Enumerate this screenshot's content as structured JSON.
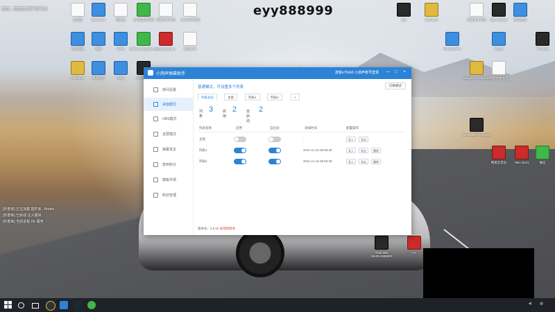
{
  "stream": {
    "title": "eyy888999",
    "top_left_text": "嘿嘿...嘿嘿嘿   网干还不来",
    "log_lines": [
      "[外部库] 正在加载 插件库...Hooks",
      "[外部库] 已启动 注入模块",
      "[外部库] 当前进程 DE 服务"
    ]
  },
  "desktop_icons": [
    {
      "label": "此电脑",
      "style": "doc"
    },
    {
      "label": "Bandicam",
      "style": "blue"
    },
    {
      "label": "回收站",
      "style": "doc"
    },
    {
      "label": "360安全浏览器",
      "style": "green"
    },
    {
      "label": "新建文本文档",
      "style": "doc"
    },
    {
      "label": "2021年终总结",
      "style": "doc"
    },
    {
      "label": "控制面板",
      "style": "blue"
    },
    {
      "label": "网络",
      "style": "blue"
    },
    {
      "label": "WPS",
      "style": "blue"
    },
    {
      "label": "GeForce Experience",
      "style": "green"
    },
    {
      "label": "Redeemtoken",
      "style": "red"
    },
    {
      "label": "新建文本",
      "style": "doc"
    },
    {
      "label": "WeGame",
      "style": "yellow"
    },
    {
      "label": "暴风影音",
      "style": "blue"
    },
    {
      "label": "Uplay",
      "style": "blue"
    },
    {
      "label": "Overwatch",
      "style": "dark"
    },
    {
      "label": "QQ",
      "style": "dark"
    },
    {
      "label": "WeGame",
      "style": "yellow"
    },
    {
      "label": "新建文本文档",
      "style": "doc"
    },
    {
      "label": "Epic Games",
      "style": "dark"
    },
    {
      "label": "腾讯会议",
      "style": "blue"
    },
    {
      "label": "DiamondPro",
      "style": "blue"
    },
    {
      "label": "Steam",
      "style": "blue"
    },
    {
      "label": "TI Cards",
      "style": "dark"
    },
    {
      "label": "League of Legends",
      "style": "yellow"
    },
    {
      "label": "新建文本文档",
      "style": "doc"
    },
    {
      "label": "网易云音乐",
      "style": "red"
    },
    {
      "label": "Overwatch Prologue",
      "style": "dark"
    },
    {
      "label": "NBA 2K21",
      "style": "red"
    },
    {
      "label": "微信",
      "style": "green"
    },
    {
      "label": "Total War WARHAMMER",
      "style": "dark"
    },
    {
      "label": "LA",
      "style": "red"
    }
  ],
  "app": {
    "title": "小鸽声弹幕助手",
    "account": "游客e70eb6   小鸽声账号登录",
    "controls": [
      "—",
      "□",
      "×"
    ],
    "nav": [
      {
        "label": "房间设置",
        "active": false
      },
      {
        "label": "桌面模式",
        "active": true
      },
      {
        "label": "OBS模式",
        "active": false
      },
      {
        "label": "全屏模式",
        "active": false
      },
      {
        "label": "弹幕发言",
        "active": false
      },
      {
        "label": "签到积分",
        "active": false
      },
      {
        "label": "模板市场",
        "active": false
      },
      {
        "label": "粉丝管理",
        "active": false
      }
    ],
    "mode_title": "普通模式，可设置多个列表",
    "switch_btn": "切换模式",
    "tabs": [
      "列表总览",
      "主窗",
      "列表1",
      "列表2",
      "+"
    ],
    "stats": [
      {
        "label": "列表",
        "value": "3"
      },
      {
        "label": "启用",
        "value": "2"
      },
      {
        "label": "自启动",
        "value": "2"
      }
    ],
    "columns": [
      "列表名称",
      "启用",
      "自启动",
      "添加时间",
      "配置操作"
    ],
    "rows": [
      {
        "name": "主窗",
        "enabled": false,
        "autostart": false,
        "time": "-",
        "actions": [
          "导入",
          "导出"
        ]
      },
      {
        "name": "列表1",
        "enabled": true,
        "autostart": true,
        "time": "2021-11-18 08:56:39",
        "actions": [
          "导入",
          "导出",
          "删除"
        ]
      },
      {
        "name": "列表2",
        "enabled": true,
        "autostart": true,
        "time": "2021-11-18 08:56:39",
        "actions": [
          "导入",
          "导出",
          "删除"
        ]
      }
    ],
    "version_label": "版本号：",
    "version": "3.5.10",
    "update_link": "发现新版本"
  },
  "taskbar": {
    "time": "",
    "tray_text": "中",
    "colors": {
      "bar": "#1f2226",
      "accent": "#2c83d6"
    }
  }
}
